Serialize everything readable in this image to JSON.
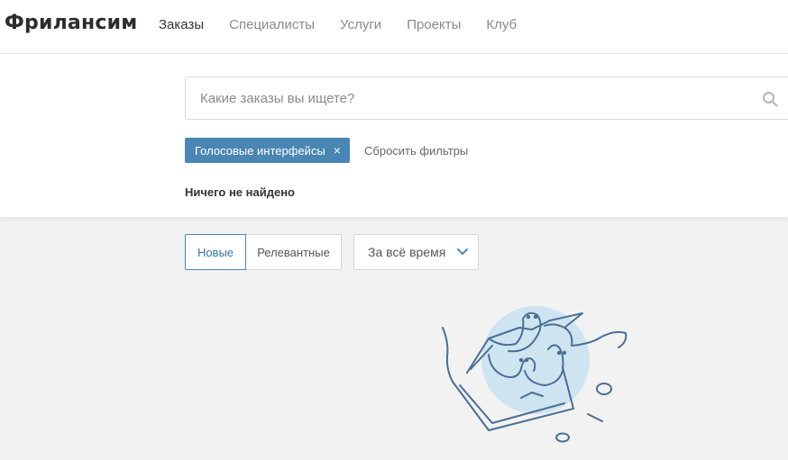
{
  "app": {
    "logo": "Фрилансим"
  },
  "nav": {
    "items": [
      {
        "label": "Заказы",
        "active": true
      },
      {
        "label": "Специалисты",
        "active": false
      },
      {
        "label": "Услуги",
        "active": false
      },
      {
        "label": "Проекты",
        "active": false
      },
      {
        "label": "Клуб",
        "active": false
      }
    ]
  },
  "search": {
    "placeholder": "Какие заказы вы ищете?",
    "value": "",
    "icon": "search-icon"
  },
  "filters": {
    "active_tag": "Голосовые интерфейсы",
    "tag_close": "×",
    "reset_label": "Сбросить фильтры"
  },
  "results": {
    "empty_text": "Ничего не найдено"
  },
  "sort": {
    "options": [
      {
        "label": "Новые",
        "active": true
      },
      {
        "label": "Релевантные",
        "active": false
      }
    ]
  },
  "period": {
    "selected": "За всё время",
    "icon": "chevron-down-icon"
  },
  "colors": {
    "accent": "#4a86b3",
    "background": "#f2f2f2",
    "illustration_fill": "#cfe4f1",
    "illustration_stroke": "#4a6f94"
  }
}
